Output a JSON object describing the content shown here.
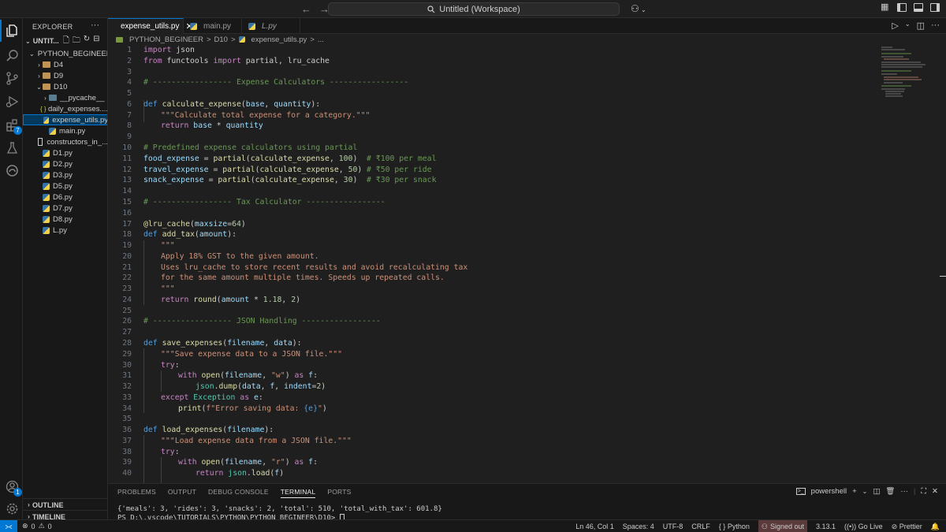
{
  "titlebar": {
    "back": "←",
    "forward": "→",
    "search_text": "Untitled (Workspace)"
  },
  "activity": {
    "extensions_badge": "7",
    "accounts_badge": "1"
  },
  "explorer": {
    "title": "EXPLORER",
    "more": "···",
    "workspace": "UNTIT...",
    "root_folder": "PYTHON_BEGINEER",
    "items": [
      {
        "label": "D4",
        "kind": "folder",
        "depth": 1
      },
      {
        "label": "D9",
        "kind": "folder",
        "depth": 1
      },
      {
        "label": "D10",
        "kind": "folder",
        "depth": 1
      },
      {
        "label": "__pycache__",
        "kind": "folder",
        "depth": 2
      },
      {
        "label": "daily_expenses....",
        "kind": "json",
        "depth": 2
      },
      {
        "label": "expense_utils.py",
        "kind": "py",
        "depth": 2
      },
      {
        "label": "main.py",
        "kind": "py",
        "depth": 2
      },
      {
        "label": "constructors_in_...",
        "kind": "txt",
        "depth": 1
      },
      {
        "label": "D1.py",
        "kind": "py",
        "depth": 1
      },
      {
        "label": "D2.py",
        "kind": "py",
        "depth": 1
      },
      {
        "label": "D3.py",
        "kind": "py",
        "depth": 1
      },
      {
        "label": "D5.py",
        "kind": "py",
        "depth": 1
      },
      {
        "label": "D6.py",
        "kind": "py",
        "depth": 1
      },
      {
        "label": "D7.py",
        "kind": "py",
        "depth": 1
      },
      {
        "label": "D8.py",
        "kind": "py",
        "depth": 1
      },
      {
        "label": "L.py",
        "kind": "py",
        "depth": 1
      }
    ],
    "outline": "OUTLINE",
    "timeline": "TIMELINE"
  },
  "tabs": [
    {
      "label": "expense_utils.py",
      "close": "✕"
    },
    {
      "label": "main.py"
    },
    {
      "label": "L.py"
    }
  ],
  "breadcrumb": {
    "part1": "PYTHON_BEGINEER",
    "sep": ">",
    "part2": "D10",
    "part3": "expense_utils.py",
    "part4": "..."
  },
  "code_lines": [
    {
      "n": "1"
    },
    {
      "n": "2"
    },
    {
      "n": "3"
    },
    {
      "n": "4"
    },
    {
      "n": "5"
    },
    {
      "n": "6"
    },
    {
      "n": "7"
    },
    {
      "n": "8"
    },
    {
      "n": "9"
    },
    {
      "n": "10"
    },
    {
      "n": "11"
    },
    {
      "n": "12"
    },
    {
      "n": "13"
    },
    {
      "n": "14"
    },
    {
      "n": "15"
    },
    {
      "n": "16"
    },
    {
      "n": "17"
    },
    {
      "n": "18"
    },
    {
      "n": "19"
    },
    {
      "n": "20"
    },
    {
      "n": "21"
    },
    {
      "n": "22"
    },
    {
      "n": "23"
    },
    {
      "n": "24"
    },
    {
      "n": "25"
    },
    {
      "n": "26"
    },
    {
      "n": "27"
    },
    {
      "n": "28"
    },
    {
      "n": "29"
    },
    {
      "n": "30"
    },
    {
      "n": "31"
    },
    {
      "n": "32"
    },
    {
      "n": "33"
    },
    {
      "n": "34"
    },
    {
      "n": "35"
    },
    {
      "n": "36"
    },
    {
      "n": "37"
    },
    {
      "n": "38"
    },
    {
      "n": "39"
    },
    {
      "n": "40"
    }
  ],
  "code": {
    "l1": [
      "import",
      " json"
    ],
    "l2": [
      "from",
      " functools ",
      "import",
      " partial, lru_cache"
    ],
    "l4": "# ----------------- Expense Calculators -----------------",
    "l6": [
      "def",
      "calculate_expense",
      "(",
      "base",
      ", ",
      "quantity",
      "):"
    ],
    "l7": "\"\"\"Calculate total expense for a category.\"\"\"",
    "l8": [
      "return",
      "base",
      " * ",
      "quantity"
    ],
    "l10": "# Predefined expense calculators using partial",
    "l11": [
      "food_expense",
      " = ",
      "partial",
      "(",
      "calculate_expense",
      ", ",
      "100",
      ")",
      "# ₹100 per meal"
    ],
    "l12": [
      "travel_expense",
      " = ",
      "partial",
      "(",
      "calculate_expense",
      ", ",
      "50",
      ")",
      "# ₹50 per ride"
    ],
    "l13": [
      "snack_expense",
      " = ",
      "partial",
      "(",
      "calculate_expense",
      ", ",
      "30",
      ")",
      "# ₹30 per snack"
    ],
    "l15": "# ----------------- Tax Calculator -----------------",
    "l17": [
      "@lru_cache",
      "(",
      "maxsize",
      "=",
      "64",
      ")"
    ],
    "l18": [
      "def",
      "add_tax",
      "(",
      "amount",
      "):"
    ],
    "l19": "\"\"\"",
    "l20": "Apply 18% GST to the given amount.",
    "l21": "Uses lru_cache to store recent results and avoid recalculating tax",
    "l22": "for the same amount multiple times. Speeds up repeated calls.",
    "l23": "\"\"\"",
    "l24": [
      "return",
      "round",
      "(",
      "amount",
      " * ",
      "1.18",
      ", ",
      "2",
      ")"
    ],
    "l26": "# ----------------- JSON Handling -----------------",
    "l28": [
      "def",
      "save_expenses",
      "(",
      "filename",
      ", ",
      "data",
      "):"
    ],
    "l29": "\"\"\"Save expense data to a JSON file.\"\"\"",
    "l30": [
      "try",
      ":"
    ],
    "l31": [
      "with",
      "open",
      "(",
      "filename",
      ", ",
      "\"w\"",
      ") ",
      "as",
      " f",
      ":"
    ],
    "l32": [
      "json",
      ".",
      "dump",
      "(",
      "data",
      ", ",
      "f",
      ", ",
      "indent",
      "=",
      "2",
      ")"
    ],
    "l33": [
      "except",
      "Exception",
      " ",
      "as",
      " e",
      ":"
    ],
    "l34": [
      "print",
      "(",
      "f\"Error saving data: ",
      "{e}",
      "\"",
      ")"
    ],
    "l36": [
      "def",
      "load_expenses",
      "(",
      "filename",
      "):"
    ],
    "l37": "\"\"\"Load expense data from a JSON file.\"\"\"",
    "l38": [
      "try",
      ":"
    ],
    "l39": [
      "with",
      "open",
      "(",
      "filename",
      ", ",
      "\"r\"",
      ") ",
      "as",
      " f",
      ":"
    ],
    "l40": [
      "return",
      "json",
      ".",
      "load",
      "(",
      "f",
      ")"
    ]
  },
  "panel": {
    "tabs": [
      "PROBLEMS",
      "OUTPUT",
      "DEBUG CONSOLE",
      "TERMINAL",
      "PORTS"
    ],
    "shell": "powershell",
    "output": "{'meals': 3, 'rides': 3, 'snacks': 2, 'total': 510, 'total_with_tax': 601.8}",
    "prompt": "PS D:\\.vscode\\TUTORIALS\\PYTHON\\PYTHON_BEGINEER\\D10> "
  },
  "status": {
    "errors": "0",
    "warnings": "0",
    "position": "Ln 46, Col 1",
    "spaces": "Spaces: 4",
    "encoding": "UTF-8",
    "eol": "CRLF",
    "language": "Python",
    "signed_out": "Signed out",
    "version": "3.13.1",
    "golive": "Go Live",
    "prettier": "Prettier"
  },
  "colors": {
    "accent": "#0078d4",
    "background": "#1f1f1f",
    "sidebar": "#181818",
    "selection": "#04395e",
    "keyword": "#569cd6",
    "control": "#c586c0",
    "function": "#dcdcaa",
    "string": "#ce9178",
    "comment": "#6a9955",
    "number": "#b5cea8",
    "variable": "#9cdcfe"
  }
}
